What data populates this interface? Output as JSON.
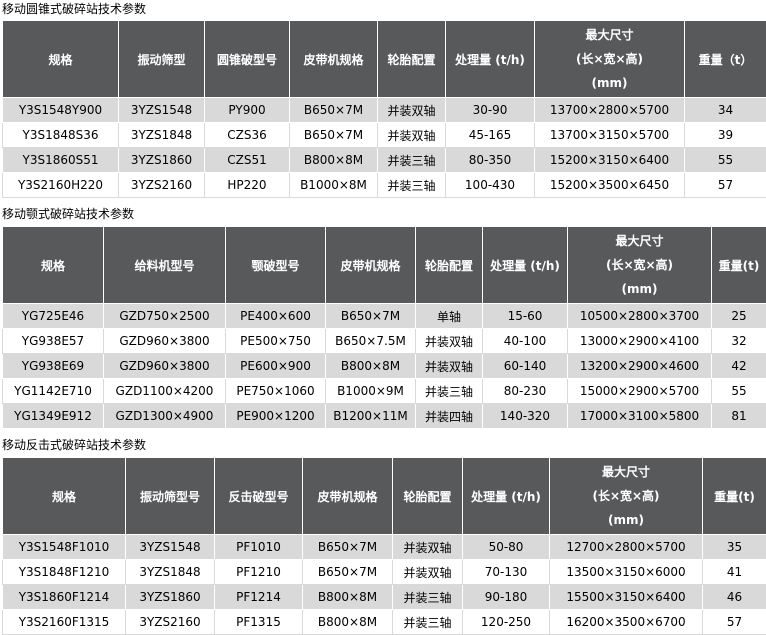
{
  "sections": [
    {
      "title": "移动圆锥式破碎站技术参数",
      "headers": [
        "规格",
        "振动筛型",
        "圆锥破型号",
        "皮带机规格",
        "轮胎配置",
        "处理量 (t/h)",
        "最大尺寸",
        "(长×宽×高)",
        "(mm)",
        "重量（t）"
      ],
      "rows": [
        [
          "Y3S1548Y900",
          "3YZS1548",
          "PY900",
          "B650×7M",
          "并装双轴",
          "30-90",
          "13700×2800×5700",
          "34"
        ],
        [
          "Y3S1848S36",
          "3YZS1848",
          "CZS36",
          "B650×7M",
          "并装双轴",
          "45-165",
          "13700×3150×5700",
          "39"
        ],
        [
          "Y3S1860S51",
          "3YZS1860",
          "CZS51",
          "B800×8M",
          "并装三轴",
          "80-350",
          "15200×3150×6400",
          "55"
        ],
        [
          "Y3S2160H220",
          "3YZS2160",
          "HP220",
          "B1000×8M",
          "并装三轴",
          "100-430",
          "15200×3500×6450",
          "57"
        ]
      ]
    },
    {
      "title": "移动颚式破碎站技术参数",
      "headers": [
        "规格",
        "给料机型号",
        "颚破型号",
        "皮带机规格",
        "轮胎配置",
        "处理量 (t/h)",
        "最大尺寸",
        "(长×宽×高)",
        "(mm)",
        "重量(t)"
      ],
      "rows": [
        [
          "YG725E46",
          "GZD750×2500",
          "PE400×600",
          "B650×7M",
          "单轴",
          "15-60",
          "10500×2800×3700",
          "25"
        ],
        [
          "YG938E57",
          "GZD960×3800",
          "PE500×750",
          "B650×7.5M",
          "并装双轴",
          "40-100",
          "13000×2900×4100",
          "32"
        ],
        [
          "YG938E69",
          "GZD960×3800",
          "PE600×900",
          "B800×8M",
          "并装双轴",
          "60-140",
          "13200×2900×4600",
          "42"
        ],
        [
          "YG1142E710",
          "GZD1100×4200",
          "PE750×1060",
          "B1000×9M",
          "并装三轴",
          "80-230",
          "15000×2900×5700",
          "55"
        ],
        [
          "YG1349E912",
          "GZD1300×4900",
          "PE900×1200",
          "B1200×11M",
          "并装四轴",
          "140-320",
          "17000×3100×5800",
          "81"
        ]
      ]
    },
    {
      "title": "移动反击式破碎站技术参数",
      "headers": [
        "规格",
        "振动筛型号",
        "反击破型号",
        "皮带机规格",
        "轮胎配置",
        "处理量 (t/h)",
        "最大尺寸",
        "(长×宽×高)",
        "(mm)",
        "重量(t)"
      ],
      "rows": [
        [
          "Y3S1548F1010",
          "3YZS1548",
          "PF1010",
          "B650×7M",
          "并装双轴",
          "50-80",
          "12700×2800×5700",
          "35"
        ],
        [
          "Y3S1848F1210",
          "3YZS1848",
          "PF1210",
          "B650×7M",
          "并装双轴",
          "70-130",
          "13500×3150×6000",
          "41"
        ],
        [
          "Y3S1860F1214",
          "3YZS1860",
          "PF1214",
          "B800×8M",
          "并装三轴",
          "90-180",
          "15500×3150×6400",
          "46"
        ],
        [
          "Y3S2160F1315",
          "3YZS2160",
          "PF1315",
          "B800×8M",
          "并装三轴",
          "120-250",
          "16200×3500×6700",
          "57"
        ]
      ]
    }
  ]
}
